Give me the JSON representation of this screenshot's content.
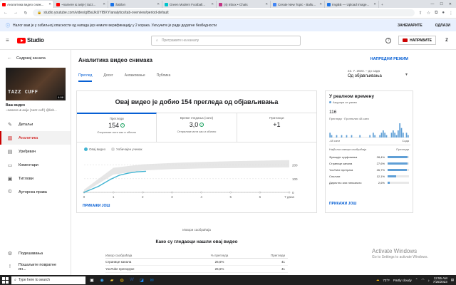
{
  "browser": {
    "tabs": [
      {
        "label": "Аналитика видео сниж...",
        "color": "#ff0000",
        "active": true
      },
      {
        "label": "~namere & avije | tazz...",
        "color": "#ff0000",
        "active": false
      },
      {
        "label": "Šablon",
        "color": "#1a73e8",
        "active": false
      },
      {
        "label": "Green Modern Football...",
        "color": "#00c4cc",
        "active": false
      },
      {
        "label": "(4) Inbox • Chats",
        "color": "#c13584",
        "active": false
      },
      {
        "label": "Create New Topic - Ballu...",
        "color": "#4285f4",
        "active": false
      },
      {
        "label": "ImgBB — Upload Image...",
        "color": "#1a73e8",
        "active": false
      }
    ],
    "url": "studio.youtube.com/video/gIBaUkUYIBXY/analytics/tab-overview/period-default"
  },
  "banner": {
    "text": "Налог вам је у озбиљној опасности од напада јер немате верификацију у 2 корака. Укључите је ради додатне безбедности",
    "dismiss": "ЗАНЕМАРИТЕ",
    "enable": "ОДЛАЗИ"
  },
  "header": {
    "logo": "Studio",
    "search_placeholder": "Претражите на каналу",
    "create": "НАПРАВИТЕ",
    "avatar": "Z"
  },
  "sidebar": {
    "back": "Садржај канала",
    "thumb_title": "TAZZ CUFF",
    "duration": "4:08",
    "video_label": "Ваш видео",
    "video_name": "~namere & avije | tazz cuff | @lish...",
    "items": [
      {
        "label": "Детаљи",
        "icon": "✎"
      },
      {
        "label": "Аналитика",
        "icon": "▥"
      },
      {
        "label": "Уређивач",
        "icon": "▤"
      },
      {
        "label": "Коментари",
        "icon": "▭"
      },
      {
        "label": "Титлови",
        "icon": "▣"
      },
      {
        "label": "Ауторска права",
        "icon": "©"
      }
    ],
    "bottom": [
      {
        "label": "Подешавања",
        "icon": "⚙"
      },
      {
        "label": "Пошаљите повратне ин...",
        "icon": "!"
      }
    ]
  },
  "main": {
    "title": "Аналитика видео снимака",
    "advanced": "НАПРЕДНИ РЕЖИМ",
    "tabs": [
      "Преглед",
      "Досег",
      "Ангажовање",
      "Публика"
    ],
    "date_range": "22. 7. 2023. – до сада",
    "date_value": "Од објављивања",
    "card_headline": "Овај видео је добио 154 прегледа од објављивања",
    "metrics": [
      {
        "label": "Прегледи",
        "value": "154",
        "check": true,
        "sub": "Отприлике исти као и обично"
      },
      {
        "label": "Време гледања (сати)",
        "value": "3,0",
        "check": true,
        "sub": "Отприлике исти као и обично"
      },
      {
        "label": "Пратиоци",
        "value": "+1",
        "check": false,
        "sub": ""
      }
    ],
    "legend": {
      "this_video": "Овај видео",
      "typical": "Уобичајен учинак"
    },
    "more": "ПРИКАЖИ ЈОШ",
    "traffic_label": "Извори саобраћаја",
    "viewers_title": "Како су гледаоци нашли овај видео",
    "traffic_table": {
      "headers": [
        "Извор саобраћаја",
        "% прегледа",
        "Прегледи"
      ],
      "rows": [
        [
          "Странице канала",
          "26,6%",
          "41"
        ],
        [
          "YouTube препоруке",
          "26,6%",
          "41"
        ]
      ]
    }
  },
  "realtime": {
    "title": "У реалном времену",
    "updating": "Ажурира се уживо",
    "number": "116",
    "caption": "Прегледи · Протеклих 48 сати",
    "axis_left": "-48 сати",
    "axis_right": "Сада",
    "thead_left": "Најбољи извори саобраћаја",
    "thead_right": "Прегледи",
    "rows": [
      {
        "name": "Функције сурфовања",
        "pct": "28,4%",
        "frac": 0.284
      },
      {
        "name": "Странице канала",
        "pct": "27,6%",
        "frac": 0.276
      },
      {
        "name": "YouTube претрага",
        "pct": "26,7%",
        "frac": 0.267
      },
      {
        "name": "Спољни",
        "pct": "12,1%",
        "frac": 0.121
      },
      {
        "name": "Директно или непознато",
        "pct": "2,6%",
        "frac": 0.026
      }
    ],
    "more": "ПРИКАЖИ ЈОШ"
  },
  "watermark": {
    "line1": "Activate Windows",
    "line2": "Go to Settings to activate Windows."
  },
  "taskbar": {
    "search": "Type here to search",
    "temp": "73°F",
    "weather": "Partly cloudy",
    "time": "12:55 AM",
    "date": "7/25/2023"
  },
  "chart_data": [
    {
      "type": "line",
      "title": "",
      "x": [
        0,
        1,
        2,
        3,
        4,
        5,
        6,
        7
      ],
      "x_tick_labels": [
        "0",
        "1",
        "2",
        "3",
        "4",
        "5",
        "6",
        "7 дана"
      ],
      "y_tick_labels": [
        "0",
        "100",
        "200"
      ],
      "ylim": [
        0,
        250
      ],
      "series": [
        {
          "name": "Овај видео",
          "x": [
            0,
            0.5,
            0.9,
            1.2,
            1.5,
            1.8,
            2.1
          ],
          "y": [
            0,
            45,
            95,
            125,
            140,
            150,
            154
          ]
        },
        {
          "name": "Уобичајен учинак",
          "band": true,
          "x": [
            0,
            1,
            2,
            3,
            4,
            5,
            6,
            7
          ],
          "y_low": [
            0,
            130,
            160,
            170,
            175,
            178,
            180,
            182
          ],
          "y_high": [
            20,
            180,
            205,
            215,
            222,
            228,
            232,
            236
          ]
        }
      ]
    },
    {
      "type": "bar",
      "title": "",
      "values": [
        2,
        1,
        0,
        0,
        1,
        0,
        0,
        1,
        0,
        0,
        1,
        0,
        0,
        1,
        0,
        0,
        0,
        0,
        1,
        0,
        0,
        0,
        0,
        0,
        1,
        0,
        2,
        1,
        0,
        0,
        1,
        2,
        3,
        2,
        1,
        0,
        0,
        2,
        3,
        2,
        1,
        3,
        6,
        4,
        2,
        0,
        2,
        1
      ],
      "xlabel": "",
      "ylabel": ""
    }
  ]
}
